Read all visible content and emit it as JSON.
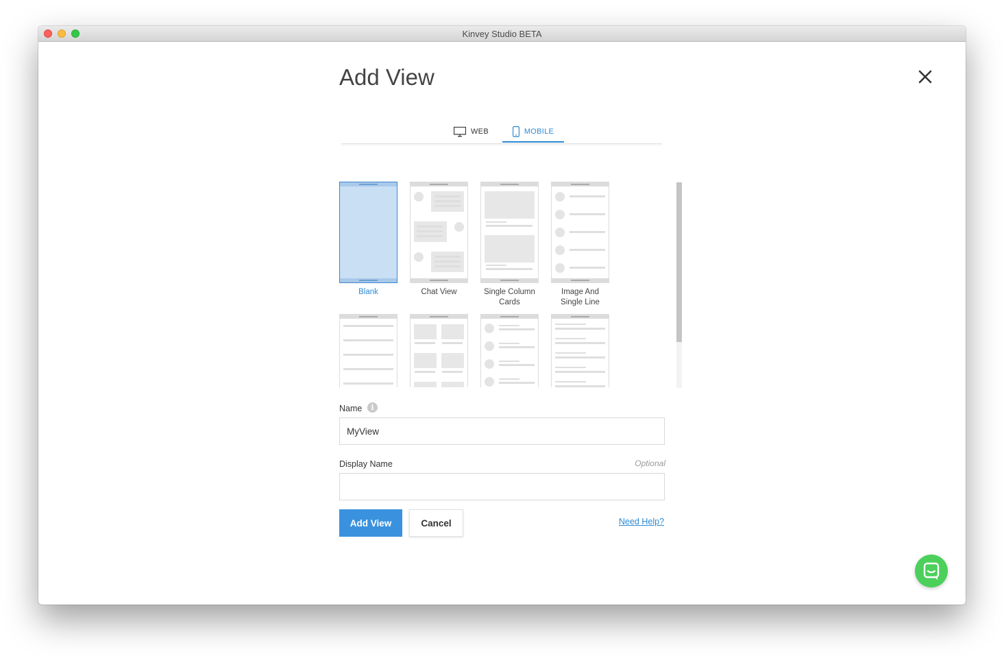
{
  "window": {
    "title": "Kinvey Studio BETA"
  },
  "dialog": {
    "title": "Add View",
    "tabs": [
      {
        "label": "WEB",
        "icon": "monitor-icon",
        "active": false
      },
      {
        "label": "MOBILE",
        "icon": "phone-icon",
        "active": true
      }
    ],
    "templates": [
      {
        "label": "Blank",
        "selected": true
      },
      {
        "label": "Chat View",
        "selected": false
      },
      {
        "label": "Single Column Cards",
        "selected": false
      },
      {
        "label": "Image And Single Line",
        "selected": false
      },
      {
        "label": "",
        "selected": false
      },
      {
        "label": "",
        "selected": false
      },
      {
        "label": "",
        "selected": false
      },
      {
        "label": "",
        "selected": false
      }
    ],
    "name_field": {
      "label": "Name",
      "value": "MyView",
      "icon": "info-icon"
    },
    "display_name_field": {
      "label": "Display Name",
      "value": "",
      "hint": "Optional"
    },
    "buttons": {
      "add": "Add View",
      "cancel": "Cancel"
    },
    "help_link": "Need Help?"
  },
  "colors": {
    "accent": "#3a92de",
    "chat_fab": "#4cd05b",
    "selected_thumb": "#c9dff4"
  }
}
